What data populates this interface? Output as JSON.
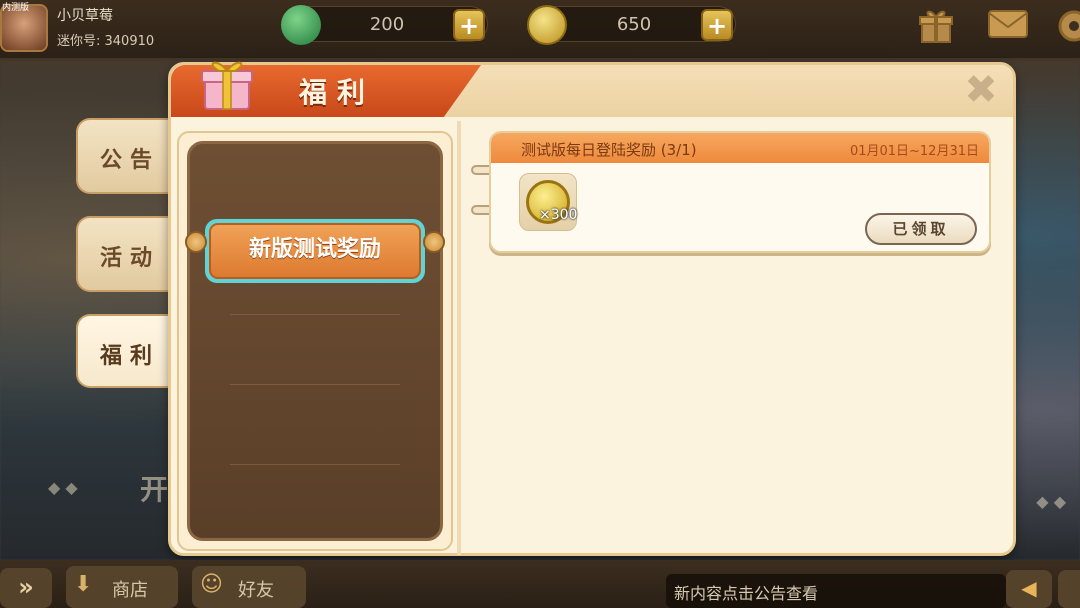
{
  "top": {
    "corner_tag": "内测版",
    "player_name": "小贝草莓",
    "player_id": "迷你号: 340910",
    "gems": "200",
    "coins": "650",
    "plus": "+"
  },
  "side_tabs": [
    {
      "label": "公告",
      "active": false
    },
    {
      "label": "活动",
      "active": false
    },
    {
      "label": "福利",
      "active": true
    }
  ],
  "panel": {
    "title": "福利",
    "close_symbol": "✖",
    "list_items": [
      {
        "label": "新版测试奖励",
        "selected": true
      }
    ],
    "reward": {
      "title": "测试版每日登陆奖励 (3/1)",
      "date_range": "01月01日~12月31日",
      "item_quantity": "×300",
      "item_icon": "coin-icon",
      "button_label": "已领取"
    }
  },
  "background": {
    "partial_text": "开",
    "dots": "◆ ◆"
  },
  "bottom": {
    "arrow": "»",
    "shop_label": "商店",
    "friend_label": "好友",
    "notice": "新内容点击公告查看"
  },
  "colors": {
    "title_ribbon": "#dc5a24",
    "selected_item_outline": "#5fd3d6",
    "card_header": "#f29a4e",
    "panel_bg": "#fcf3df"
  }
}
